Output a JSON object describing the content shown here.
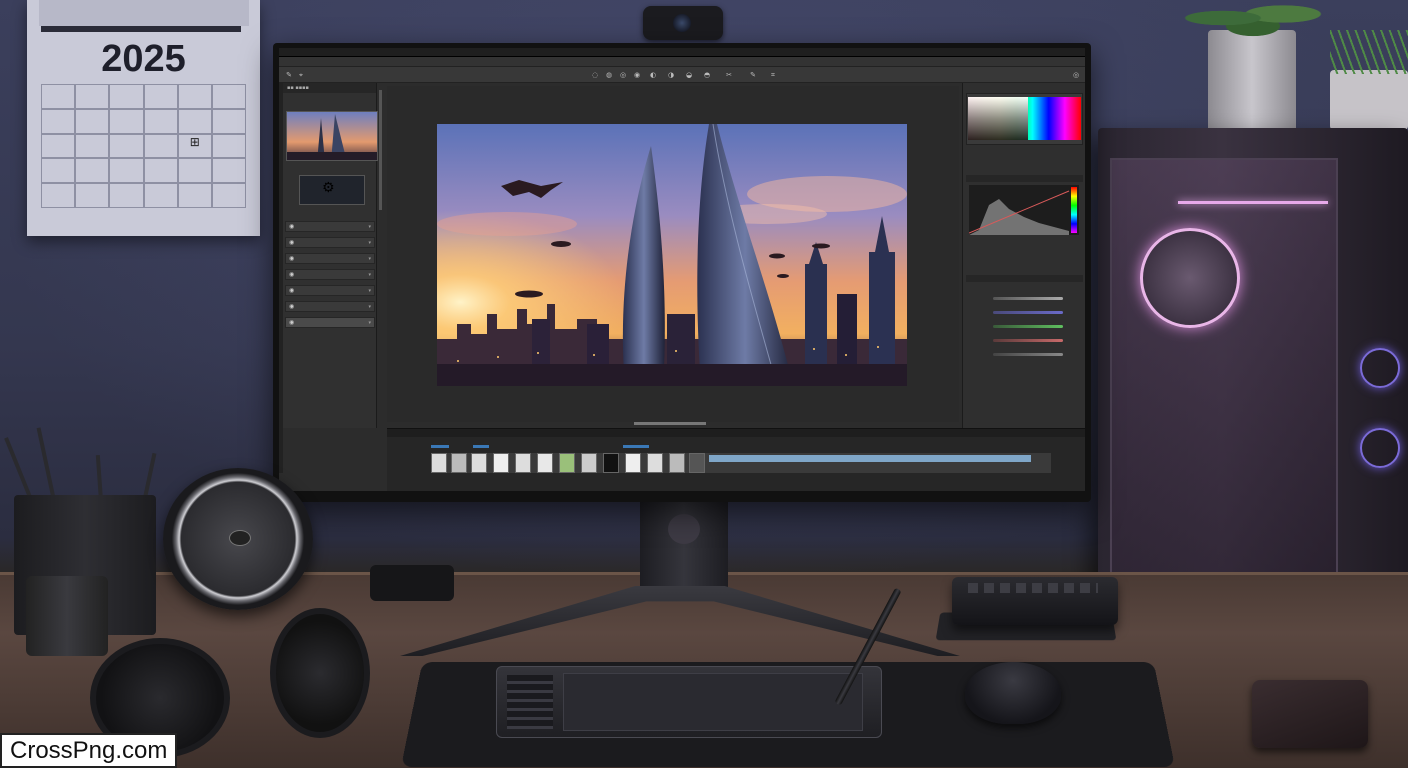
{
  "calendar": {
    "year": "2025",
    "mark_glyph": "⊞"
  },
  "watermark": "CrossPng.com",
  "screen": {
    "app": "image editor",
    "menu_items": [
      "▪ ▪ ▪▪▪▪▪▪",
      "▪▪▪▪ ▪▪ ▪▪▪▪▪"
    ],
    "left_panel": {
      "title": "▪▪ ▪▪▪▪",
      "layer_rows": 7
    },
    "icons": {
      "visibility": "eye-icon",
      "chevron": "chevron-down-icon",
      "tool": "tool-icon"
    },
    "accent_colors": {
      "timeline_blue": "#3a78b6",
      "timeline_bar": "#7fa6c8",
      "fan_rgb": "#e9b6e8",
      "case_rgb": "#7b6bd8"
    }
  }
}
